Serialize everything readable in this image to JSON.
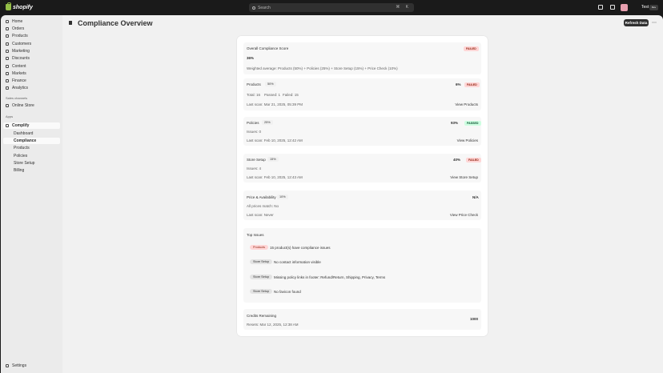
{
  "topbar": {
    "logo_text": "shopify",
    "search_placeholder": "Search",
    "search_shortcut": "⌘ K",
    "store_name": "Test",
    "store_badge": "Dev"
  },
  "sidebar": {
    "items": [
      {
        "label": "Home"
      },
      {
        "label": "Orders"
      },
      {
        "label": "Products"
      },
      {
        "label": "Customers"
      },
      {
        "label": "Marketing"
      },
      {
        "label": "Discounts"
      },
      {
        "label": "Content"
      },
      {
        "label": "Markets"
      },
      {
        "label": "Finance"
      },
      {
        "label": "Analytics"
      }
    ],
    "sales_channels_label": "Sales channels",
    "online_store": "Online Store",
    "apps_label": "Apps",
    "app_name": "Complify",
    "app_sub": [
      "Dashboard",
      "Compliance",
      "Products",
      "Policies",
      "Store Setup",
      "Billing"
    ],
    "settings": "Settings"
  },
  "main": {
    "title": "Compliance Overview",
    "refresh_label": "Refresh Data",
    "overall": {
      "heading": "Overall Compliance Score",
      "badge": "FAILED",
      "score": "36%",
      "weighted": "Weighted average: Products (50%) + Policies (25%) + Store Setup (15%) + Price Check (10%)"
    },
    "products": {
      "title": "Products",
      "weight": "50%",
      "score": "6%",
      "badge": "FAILED",
      "stats": [
        "Total: 16",
        "Passed: 1",
        "Failed: 15"
      ],
      "last_scan": "Last scan: Mar 21, 2025, 05:39 PM",
      "link": "View Products"
    },
    "policies": {
      "title": "Policies",
      "weight": "25%",
      "score": "93%",
      "badge": "PASSED",
      "issues": "Issues: 0",
      "last_scan": "Last scan: Feb 10, 2025, 12:42 AM",
      "link": "View Policies"
    },
    "store_setup": {
      "title": "Store Setup",
      "weight": "15%",
      "score": "40%",
      "badge": "FAILED",
      "issues": "Issues: 4",
      "last_scan": "Last scan: Feb 10, 2025, 12:43 AM",
      "link": "View Store Setup"
    },
    "price": {
      "title": "Price & Availability",
      "weight": "10%",
      "score": "N/A",
      "match": "All prices match: No",
      "last_scan": "Last scan: Never",
      "link": "View Price Check"
    },
    "top_issues": {
      "title": "Top Issues",
      "items": [
        {
          "category": "Products",
          "text": "15 product(s) have compliance issues"
        },
        {
          "category": "Store Setup",
          "text": "No contact information visible"
        },
        {
          "category": "Store Setup",
          "text": "Missing policy links in footer: Refund/Return, Shipping, Privacy, Terms"
        },
        {
          "category": "Store Setup",
          "text": "No favicon found"
        }
      ]
    },
    "credits": {
      "title": "Credits Remaining",
      "value": "1000",
      "resets": "Resets: Mar 12, 2025, 12:38 AM"
    }
  }
}
